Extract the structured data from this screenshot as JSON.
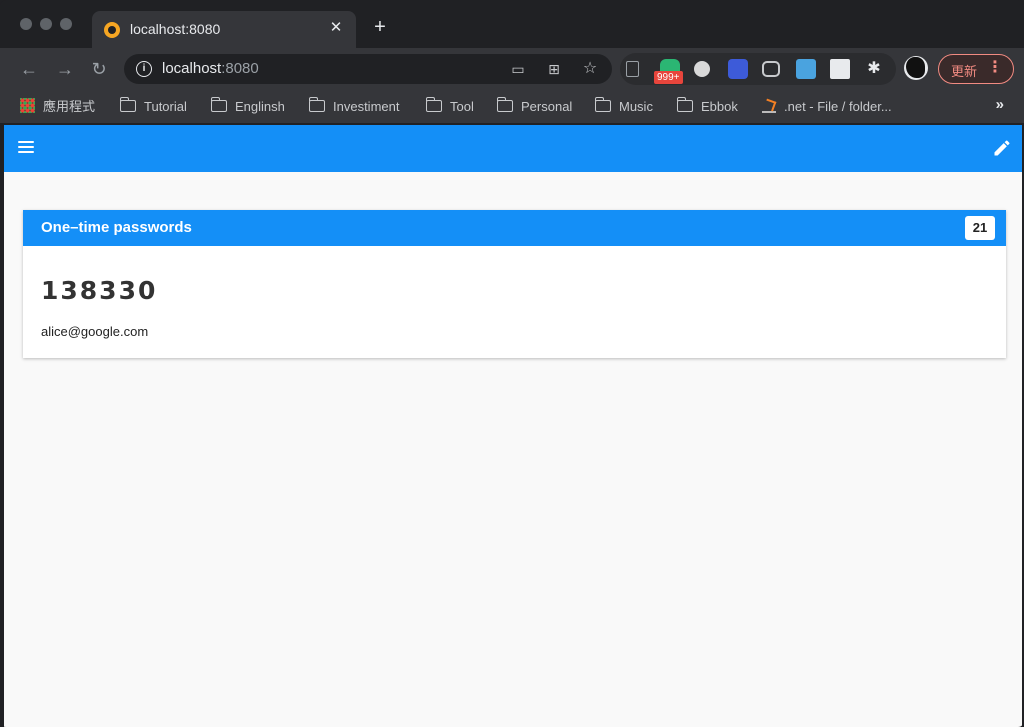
{
  "browser": {
    "tab": {
      "title": "localhost:8080",
      "close_glyph": "✕"
    },
    "new_tab_glyph": "+",
    "omnibox": {
      "host": "localhost",
      "port": ":8080"
    },
    "extensions": {
      "badge": "999+"
    },
    "update_button": {
      "label": "更新",
      "menu_glyph": "⋮"
    }
  },
  "bookmarks": {
    "items": [
      {
        "label": "應用程式",
        "icon": "apps-grid-icon"
      },
      {
        "label": "Tutorial",
        "icon": "folder-icon"
      },
      {
        "label": "Englinsh",
        "icon": "folder-icon"
      },
      {
        "label": "Investiment",
        "icon": "folder-icon"
      },
      {
        "label": "Tool",
        "icon": "folder-icon"
      },
      {
        "label": "Personal",
        "icon": "folder-icon"
      },
      {
        "label": "Music",
        "icon": "folder-icon"
      },
      {
        "label": "Ebbok",
        "icon": "folder-icon"
      },
      {
        "label": ".net - File / folder...",
        "icon": "stackoverflow-icon"
      }
    ],
    "more": "»"
  },
  "app": {
    "colors": {
      "primary": "#148ff7",
      "background": "#f9f9f9"
    },
    "card": {
      "title": "One–time passwords",
      "countdown": "21",
      "entries": [
        {
          "code": "138330",
          "account": "alice@google.com"
        }
      ]
    }
  }
}
